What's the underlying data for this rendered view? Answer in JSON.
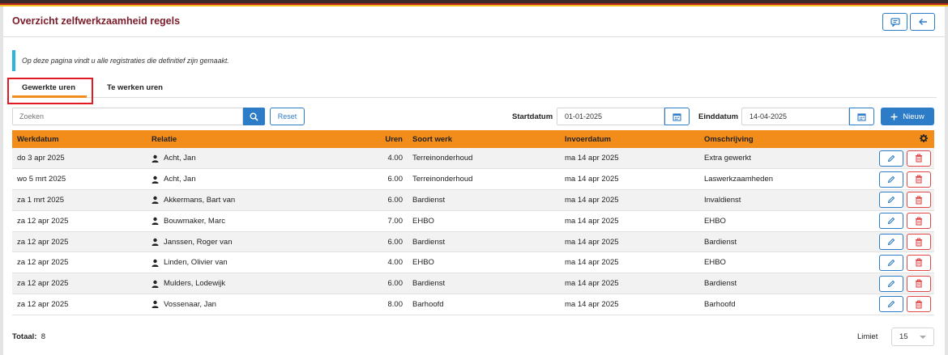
{
  "header": {
    "title": "Overzicht zelfwerkzaamheid regels"
  },
  "info": {
    "text": "Op deze pagina vindt u alle registraties die definitief zijn gemaakt."
  },
  "tabs": [
    {
      "label": "Gewerkte uren",
      "active": true
    },
    {
      "label": "Te werken uren",
      "active": false
    }
  ],
  "filters": {
    "search_placeholder": "Zoeken",
    "reset_label": "Reset",
    "start_label": "Startdatum",
    "start_value": "01-01-2025",
    "end_label": "Einddatum",
    "end_value": "14-04-2025",
    "new_label": "Nieuw"
  },
  "table": {
    "columns": [
      "Werkdatum",
      "Relatie",
      "Uren",
      "Soort werk",
      "Invoerdatum",
      "Omschrijving"
    ],
    "rows": [
      [
        "do 3 apr 2025",
        "Acht, Jan",
        "4.00",
        "Terreinonderhoud",
        "ma 14 apr 2025",
        "Extra gewerkt"
      ],
      [
        "wo 5 mrt 2025",
        "Acht, Jan",
        "6.00",
        "Terreinonderhoud",
        "ma 14 apr 2025",
        "Laswerkzaamheden"
      ],
      [
        "za 1 mrt 2025",
        "Akkermans, Bart van",
        "6.00",
        "Bardienst",
        "ma 14 apr 2025",
        "Invaldienst"
      ],
      [
        "za 12 apr 2025",
        "Bouwmaker, Marc",
        "7.00",
        "EHBO",
        "ma 14 apr 2025",
        "EHBO"
      ],
      [
        "za 12 apr 2025",
        "Janssen, Roger van",
        "6.00",
        "Bardienst",
        "ma 14 apr 2025",
        "Bardienst"
      ],
      [
        "za 12 apr 2025",
        "Linden, Olivier van",
        "4.00",
        "EHBO",
        "ma 14 apr 2025",
        "EHBO"
      ],
      [
        "za 12 apr 2025",
        "Mulders, Lodewijk",
        "6.00",
        "Bardienst",
        "ma 14 apr 2025",
        "Bardienst"
      ],
      [
        "za 12 apr 2025",
        "Vossenaar, Jan",
        "8.00",
        "Barhoofd",
        "ma 14 apr 2025",
        "Barhoofd"
      ]
    ]
  },
  "footer": {
    "total_label": "Totaal:",
    "total_value": "8",
    "limit_label": "Limiet",
    "limit_value": "15"
  },
  "colors": {
    "accent": "#2d7cc7",
    "header_orange": "#f28c1a",
    "title": "#7a1c2a",
    "danger": "#e04848"
  },
  "icons": {
    "feedback": "message-icon",
    "back": "arrow-left-icon",
    "search": "search-icon",
    "calendar": "calendar-icon",
    "user": "user-icon",
    "edit": "pencil-icon",
    "delete": "trash-icon",
    "settings": "gear-icon"
  }
}
